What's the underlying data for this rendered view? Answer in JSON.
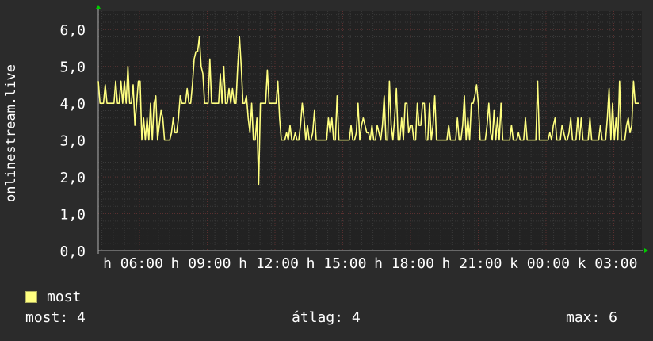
{
  "chart_data": {
    "type": "line",
    "ylabel": "onlinestream.live",
    "ylim": [
      0,
      6.5
    ],
    "y_ticks": [
      "0,0",
      "1,0",
      "2,0",
      "3,0",
      "4,0",
      "5,0",
      "6,0"
    ],
    "x_ticks": [
      "h 06:00",
      "h 09:00",
      "h 12:00",
      "h 15:00",
      "h 18:00",
      "h 21:00",
      "k 00:00",
      "k 03:00"
    ],
    "series": [
      {
        "name": "most",
        "color": "#ffff80",
        "values": [
          4.6,
          4,
          4,
          4,
          4.5,
          4,
          4,
          4,
          4,
          4,
          4.6,
          4,
          4,
          4.6,
          4,
          4.6,
          4,
          5,
          4,
          4,
          4.5,
          3.4,
          4,
          4.6,
          4.6,
          3,
          3.6,
          3,
          3.6,
          3,
          4,
          3,
          4,
          4.2,
          3,
          3.4,
          3.8,
          3.6,
          3,
          3,
          3,
          3,
          3.2,
          3.6,
          3.2,
          3.2,
          3.6,
          4.2,
          4,
          4,
          4,
          4.4,
          4,
          4,
          4.5,
          5.2,
          5.4,
          5.4,
          5.8,
          5,
          4.8,
          4,
          4,
          4,
          5.2,
          4,
          4,
          4,
          4,
          4,
          4.8,
          4,
          5,
          4,
          4,
          4.4,
          4,
          4.4,
          4,
          4,
          5,
          5.8,
          5,
          4,
          4,
          4.2,
          3.6,
          3.2,
          4,
          3,
          3,
          3.6,
          1.8,
          4,
          4,
          4,
          4,
          4.9,
          4,
          4,
          4,
          4,
          4,
          4.6,
          3.6,
          3,
          3,
          3,
          3.2,
          3,
          3.4,
          3,
          3,
          3.2,
          3,
          3,
          3.4,
          4,
          3.6,
          3,
          3.4,
          3,
          3,
          3.2,
          3.8,
          3,
          3,
          3,
          3,
          3,
          3,
          3,
          3.6,
          3.2,
          3.6,
          3,
          3,
          4.2,
          3,
          3,
          3,
          3,
          3,
          3,
          3,
          3.4,
          3,
          3,
          3.2,
          4,
          3,
          3.4,
          3.6,
          3.4,
          3.2,
          3.2,
          3,
          3.4,
          3,
          3,
          3.4,
          3.2,
          3,
          3.4,
          4.2,
          3,
          3,
          4.6,
          3.4,
          3,
          3.6,
          4.4,
          3,
          3,
          3.6,
          3,
          4,
          4,
          3.2,
          3.4,
          3.4,
          3,
          3,
          4,
          3.4,
          3.4,
          4,
          4,
          3,
          3,
          4,
          3,
          3.4,
          4.2,
          3,
          3,
          3,
          3,
          3,
          3,
          3,
          3.4,
          3,
          3,
          3,
          3,
          3.6,
          3,
          3,
          3.4,
          4.2,
          3,
          3.6,
          3,
          4,
          4,
          4.2,
          4.5,
          4,
          3,
          3,
          3,
          3,
          3.4,
          4,
          3.2,
          3,
          3.8,
          3,
          3.6,
          3,
          4,
          3,
          3,
          3,
          3,
          3,
          3.4,
          3,
          3,
          3,
          3.2,
          3,
          3,
          3,
          3.6,
          3,
          3,
          3,
          3,
          3,
          3,
          4.6,
          3,
          3,
          3,
          3,
          3,
          3,
          3.2,
          3,
          3.4,
          3.6,
          3,
          3,
          3,
          3.4,
          3.2,
          3,
          3,
          3.2,
          3.6,
          3,
          3,
          3,
          3.6,
          3,
          3.6,
          3,
          3,
          3,
          3,
          3.6,
          3,
          3,
          3,
          3,
          3,
          3.4,
          3,
          3,
          3,
          3.6,
          4.4,
          3,
          4,
          3,
          3.6,
          3,
          4.6,
          3,
          3,
          3,
          3.4,
          3.6,
          3.2,
          3.4,
          4.6,
          4,
          4,
          4
        ]
      }
    ],
    "legend": {
      "label": "most",
      "placement": "bottom-left"
    },
    "grid": true
  },
  "stats": {
    "now": "most: 4",
    "average": "átlag: 4",
    "max": "max: 6"
  },
  "colors": {
    "background": "#2b2b2b",
    "plot_background": "#222222",
    "major_grid": "#5a3030",
    "minor_grid": "#3a3a3a",
    "line": "#ffff80",
    "axis": "#b0b0b0",
    "arrow": "#00cc00"
  }
}
